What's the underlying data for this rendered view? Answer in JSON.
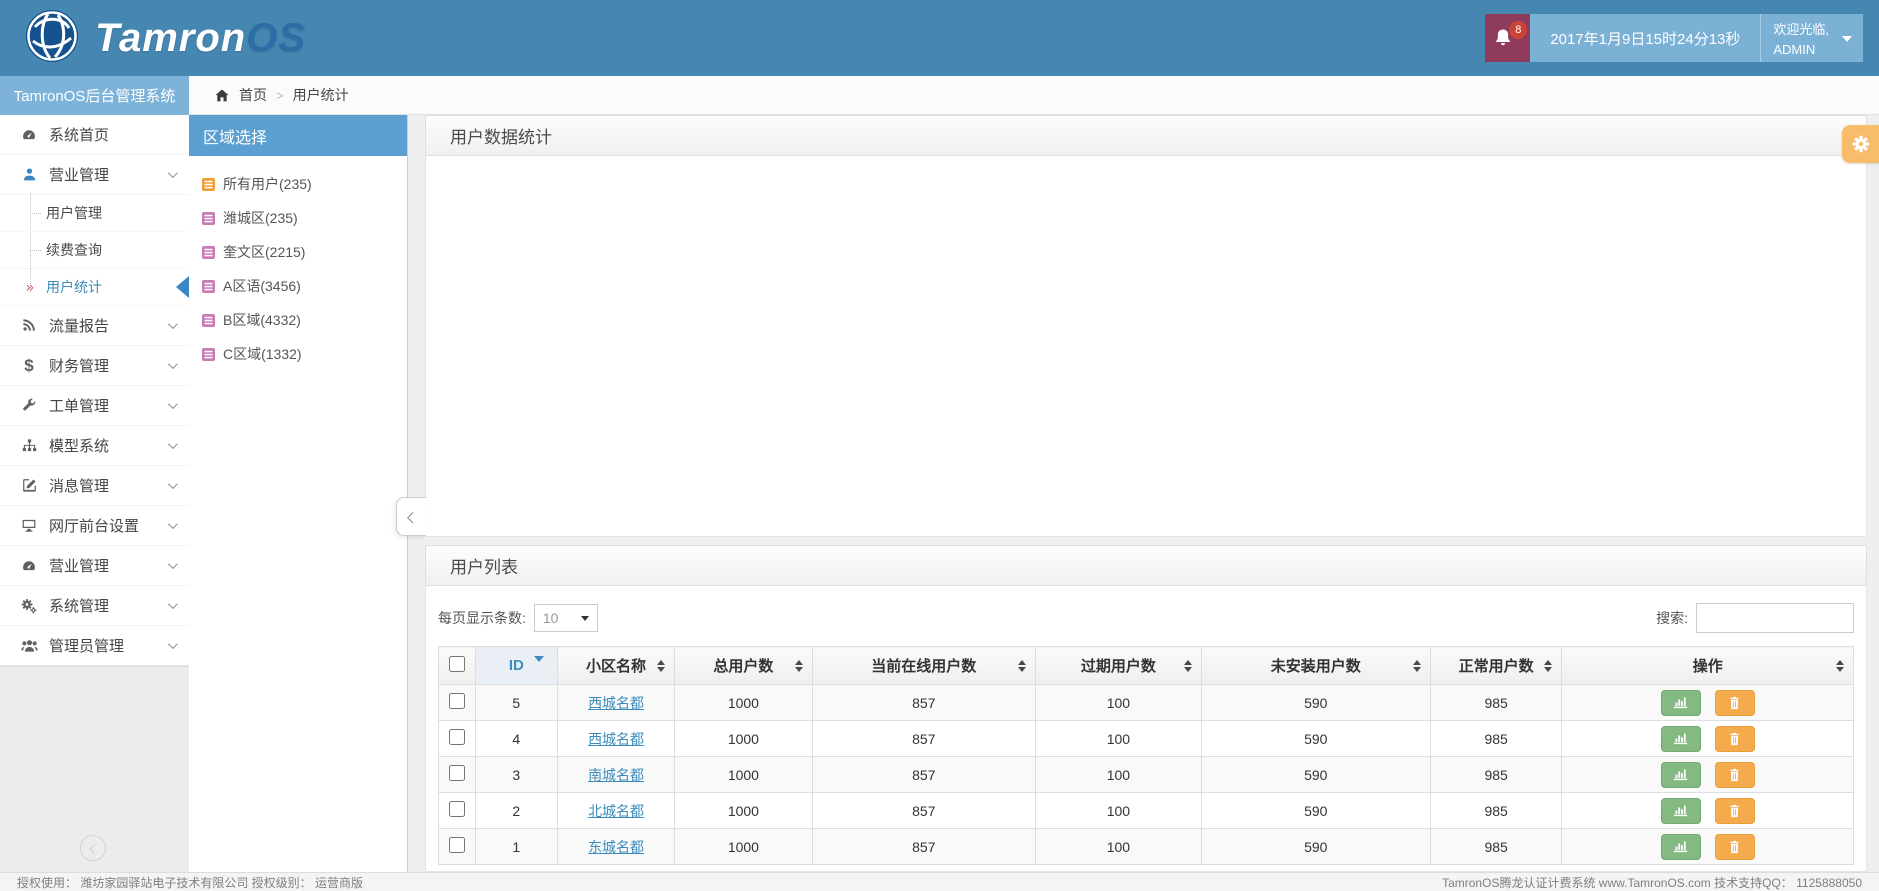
{
  "header": {
    "logo_part1": "Tamron",
    "logo_part2": "OS",
    "notification_count": "8",
    "datetime": "2017年1月9日15时24分13秒",
    "welcome_line1": "欢迎光临,",
    "welcome_line2": "ADMIN"
  },
  "sidebar": {
    "title": "TamronOS后台管理系统",
    "active_marker": "»",
    "items": [
      {
        "label": "系统首页",
        "icon": "dashboard-icon"
      },
      {
        "label": "营业管理",
        "icon": "user-icon",
        "children": [
          {
            "label": "用户管理"
          },
          {
            "label": "续费查询"
          },
          {
            "label": "用户统计",
            "active": true
          }
        ]
      },
      {
        "label": "流量报告",
        "icon": "rss-icon"
      },
      {
        "label": "财务管理",
        "icon": "dollar-icon"
      },
      {
        "label": "工单管理",
        "icon": "wrench-icon"
      },
      {
        "label": "模型系统",
        "icon": "sitemap-icon"
      },
      {
        "label": "消息管理",
        "icon": "message-edit-icon"
      },
      {
        "label": "网厅前台设置",
        "icon": "desktop-icon"
      },
      {
        "label": "营业管理",
        "icon": "dashboard-icon"
      },
      {
        "label": "系统管理",
        "icon": "gears-icon"
      },
      {
        "label": "管理员管理",
        "icon": "users-icon"
      }
    ]
  },
  "breadcrumb": {
    "home_label": "首页",
    "separator": ">",
    "current": "用户统计"
  },
  "region_panel": {
    "title": "区域选择",
    "items": [
      {
        "label": "所有用户(235)",
        "icon_color": "#f29c38"
      },
      {
        "label": "潍城区(235)",
        "icon_color": "#c97bb6"
      },
      {
        "label": "奎文区(2215)",
        "icon_color": "#c97bb6"
      },
      {
        "label": "A区语(3456)",
        "icon_color": "#c97bb6"
      },
      {
        "label": "B区域(4332)",
        "icon_color": "#c97bb6"
      },
      {
        "label": "C区域(1332)",
        "icon_color": "#c97bb6"
      }
    ]
  },
  "stats_panel": {
    "title": "用户数据统计"
  },
  "list_panel": {
    "title": "用户列表",
    "page_size_label": "每页显示条数:",
    "page_size_value": "10",
    "search_label": "搜索:",
    "columns": [
      "ID",
      "小区名称",
      "总用户数",
      "当前在线用户数",
      "过期用户数",
      "未安装用户数",
      "正常用户数",
      "操作"
    ],
    "rows": [
      {
        "id": "5",
        "name": "西城名都",
        "total": "1000",
        "online": "857",
        "expired": "100",
        "uninstalled": "590",
        "normal": "985"
      },
      {
        "id": "4",
        "name": "西城名都",
        "total": "1000",
        "online": "857",
        "expired": "100",
        "uninstalled": "590",
        "normal": "985"
      },
      {
        "id": "3",
        "name": "南城名都",
        "total": "1000",
        "online": "857",
        "expired": "100",
        "uninstalled": "590",
        "normal": "985"
      },
      {
        "id": "2",
        "name": "北城名都",
        "total": "1000",
        "online": "857",
        "expired": "100",
        "uninstalled": "590",
        "normal": "985"
      },
      {
        "id": "1",
        "name": "东城名都",
        "total": "1000",
        "online": "857",
        "expired": "100",
        "uninstalled": "590",
        "normal": "985"
      }
    ]
  },
  "footer": {
    "left": "授权使用： 潍坊家园驿站电子技术有限公司  授权级别： 运营商版",
    "right": "TamronOS腾龙认证计费系统 www.TamronOS.com 技术支持QQ： 1125888050"
  },
  "colors": {
    "header_blue": "#4687b2",
    "light_blue": "#7cb1d6",
    "panel_blue": "#5b9ed0",
    "link_blue": "#3c8dbc",
    "notif_maroon": "#8e3b5d",
    "badge_red": "#cb4335",
    "chart_btn_green": "#84ba81",
    "trash_btn_orange": "#f4ab4e",
    "gear_btn_orange": "#f7bd6b"
  }
}
